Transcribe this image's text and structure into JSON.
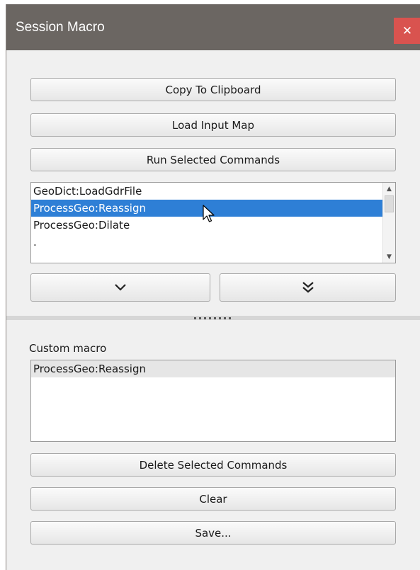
{
  "window": {
    "title": "Session Macro",
    "close_icon": "close-icon"
  },
  "toolbar": {
    "copy_label": "Copy To Clipboard",
    "load_label": "Load Input Map",
    "run_label": "Run Selected Commands"
  },
  "history": {
    "items": [
      "GeoDict:LoadGdrFile",
      "ProcessGeo:Reassign",
      "ProcessGeo:Dilate",
      "."
    ],
    "selected_index": 1
  },
  "move": {
    "down_icon": "chevron-down-icon",
    "down_all_icon": "double-chevron-down-icon"
  },
  "custom": {
    "label": "Custom macro",
    "items": [
      "ProcessGeo:Reassign"
    ]
  },
  "actions": {
    "delete_label": "Delete Selected Commands",
    "clear_label": "Clear",
    "save_label": "Save..."
  },
  "colors": {
    "titlebar": "#6b6662",
    "close": "#d9534f",
    "selection": "#2e7fd6"
  }
}
